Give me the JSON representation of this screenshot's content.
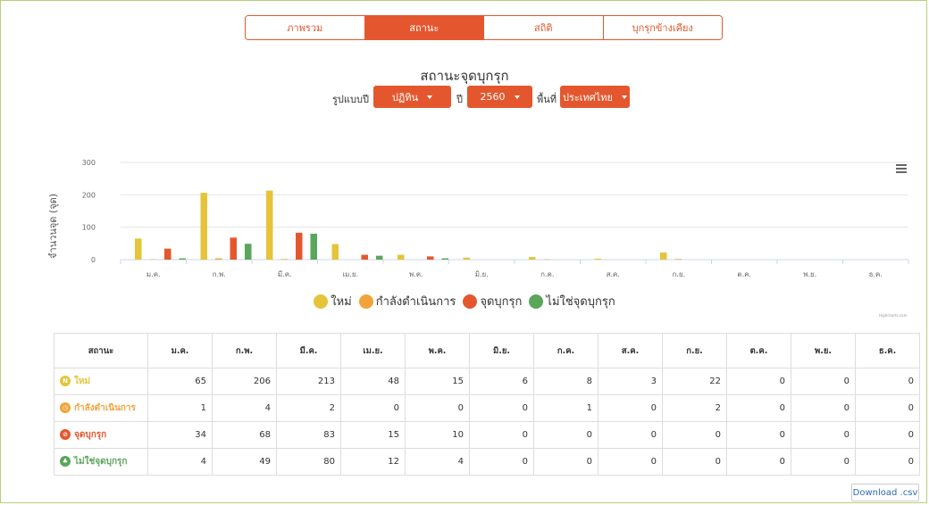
{
  "tabs": [
    {
      "label": "ภาพรวม",
      "active": false
    },
    {
      "label": "สถานะ",
      "active": true
    },
    {
      "label": "สถิติ",
      "active": false
    },
    {
      "label": "บุกรุกข้างเคียง",
      "active": false
    }
  ],
  "title": "สถานะจุดบุกรุก",
  "filters": {
    "pattern_label": "รูปแบบปี",
    "pattern_value": "ปฏิทิน",
    "year_label": "ปี",
    "year_value": "2560",
    "area_label": "พื้นที่",
    "area_value": "ประเทศไทย"
  },
  "colors": {
    "accent": "#e4572e",
    "new": "#e5c43a",
    "in_progress": "#f0a43a",
    "intrusion": "#e4572e",
    "not_intrusion": "#5aa65a"
  },
  "chart_data": {
    "type": "bar",
    "ylabel": "จำนวนจุด (จุด)",
    "ylim": [
      0,
      300
    ],
    "yticks": [
      "0",
      "100",
      "200",
      "300"
    ],
    "categories": [
      "ม.ค.",
      "ก.พ.",
      "มี.ค.",
      "เม.ย.",
      "พ.ค.",
      "มิ.ย.",
      "ก.ค.",
      "ส.ค.",
      "ก.ย.",
      "ต.ค.",
      "พ.ย.",
      "ธ.ค."
    ],
    "series": [
      {
        "name": "ใหม่",
        "color": "#e5c43a",
        "values": [
          65,
          206,
          213,
          48,
          15,
          6,
          8,
          3,
          22,
          0,
          0,
          0
        ]
      },
      {
        "name": "กำลังดำเนินการ",
        "color": "#f0a43a",
        "values": [
          1,
          4,
          2,
          0,
          0,
          0,
          1,
          0,
          2,
          0,
          0,
          0
        ]
      },
      {
        "name": "จุดบุกรุก",
        "color": "#e4572e",
        "values": [
          34,
          68,
          83,
          15,
          10,
          0,
          0,
          0,
          0,
          0,
          0,
          0
        ]
      },
      {
        "name": "ไม่ใช่จุดบุกรุก",
        "color": "#5aa65a",
        "values": [
          4,
          49,
          80,
          12,
          4,
          0,
          0,
          0,
          0,
          0,
          0,
          0
        ]
      }
    ],
    "legend": "bottom-center",
    "grid": true
  },
  "credit": "Highcharts.com",
  "table": {
    "header_status": "สถานะ",
    "months": [
      "ม.ค.",
      "ก.พ.",
      "มี.ค.",
      "เม.ย.",
      "พ.ค.",
      "มิ.ย.",
      "ก.ค.",
      "ส.ค.",
      "ก.ย.",
      "ต.ค.",
      "พ.ย.",
      "ธ.ค."
    ],
    "rows": [
      {
        "label": "ใหม่",
        "icon": "new-icon",
        "icon_glyph": "N",
        "color": "#e5c43a",
        "values": [
          "65",
          "206",
          "213",
          "48",
          "15",
          "6",
          "8",
          "3",
          "22",
          "0",
          "0",
          "0"
        ]
      },
      {
        "label": "กำลังดำเนินการ",
        "icon": "clock-icon",
        "icon_glyph": "◷",
        "color": "#f0a43a",
        "values": [
          "1",
          "4",
          "2",
          "0",
          "0",
          "0",
          "1",
          "0",
          "2",
          "0",
          "0",
          "0"
        ]
      },
      {
        "label": "จุดบุกรุก",
        "icon": "warning-icon",
        "icon_glyph": "⊘",
        "color": "#e4572e",
        "values": [
          "34",
          "68",
          "83",
          "15",
          "10",
          "0",
          "0",
          "0",
          "0",
          "0",
          "0",
          "0"
        ]
      },
      {
        "label": "ไม่ใช่จุดบุกรุก",
        "icon": "tree-icon",
        "icon_glyph": "♣",
        "color": "#5aa65a",
        "values": [
          "4",
          "49",
          "80",
          "12",
          "4",
          "0",
          "0",
          "0",
          "0",
          "0",
          "0",
          "0"
        ]
      }
    ]
  },
  "download_label": "Download .csv"
}
